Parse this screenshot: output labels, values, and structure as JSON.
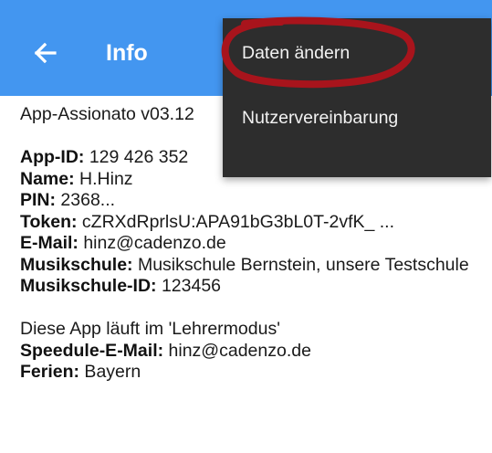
{
  "appbar": {
    "back_icon": "arrow-left-icon",
    "title": "Info",
    "color": "#4396f0"
  },
  "info": {
    "app_version": "App-Assionato v03.12",
    "app_id": {
      "label": "App-ID:",
      "value": " 129 426 352"
    },
    "name": {
      "label": "Name:",
      "value": " H.Hinz"
    },
    "pin": {
      "label": "PIN:",
      "value": " 2368..."
    },
    "token": {
      "label": "Token:",
      "value": " cZRXdRprlsU:APA91bG3bL0T-2vfK_ ..."
    },
    "email": {
      "label": "E-Mail:",
      "value": " hinz@cadenzo.de"
    },
    "musikschule": {
      "label": "Musikschule:",
      "value": " Musikschule Bernstein, unsere Testschule"
    },
    "musikschule_id": {
      "label": "Musikschule-ID:",
      "value": " 123456"
    },
    "mode_text": "Diese App läuft im 'Lehrermodus'",
    "speedule_email": {
      "label": "Speedule-E-Mail:",
      "value": " hinz@cadenzo.de"
    },
    "ferien": {
      "label": "Ferien:",
      "value": " Bayern"
    }
  },
  "menu": {
    "items": [
      {
        "label": "Daten ändern"
      },
      {
        "label": "Nutzervereinbarung"
      }
    ],
    "background": "#2d2d2d"
  },
  "annotation": {
    "color": "#a8141c"
  }
}
